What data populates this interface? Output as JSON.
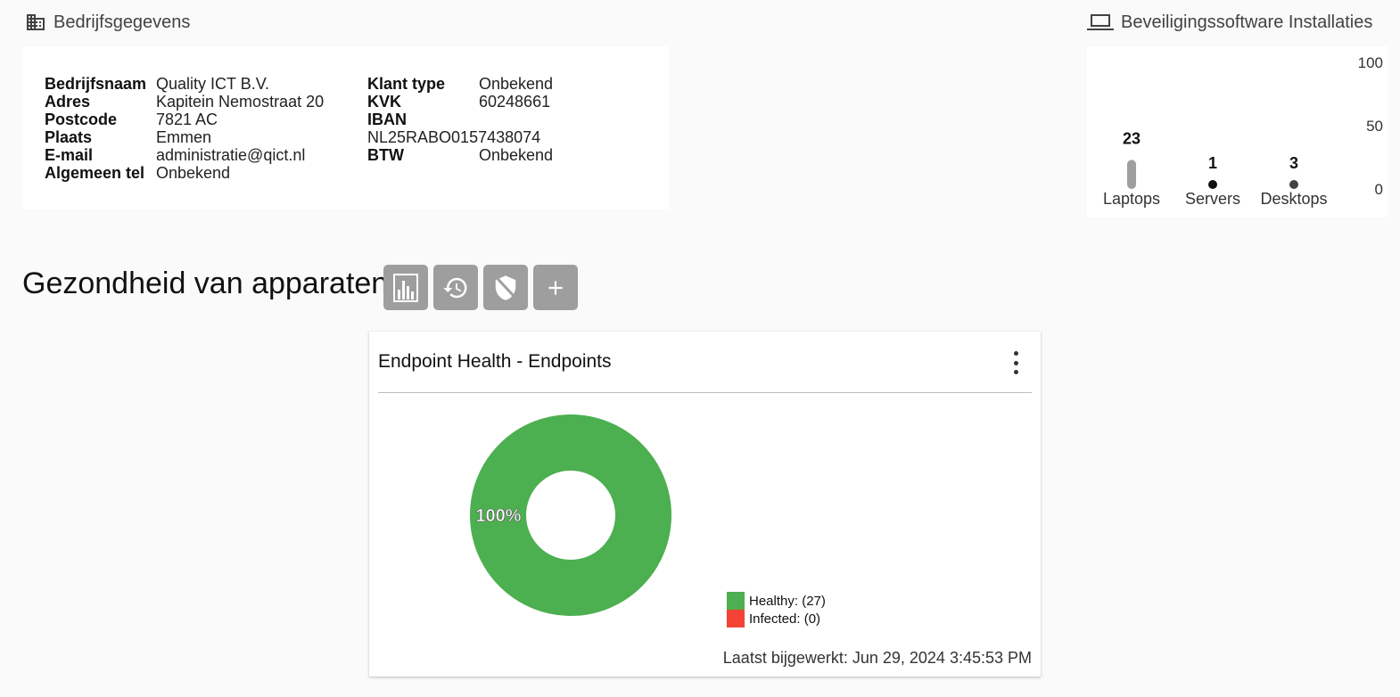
{
  "company": {
    "heading": "Bedrijfsgegevens",
    "left": [
      {
        "key": "Bedrijfsnaam",
        "value": "Quality ICT B.V."
      },
      {
        "key": "Adres",
        "value": "Kapitein Nemostraat 20"
      },
      {
        "key": "Postcode",
        "value": "7821 AC"
      },
      {
        "key": "Plaats",
        "value": "Emmen"
      },
      {
        "key": "E-mail",
        "value": "administratie@qict.nl"
      },
      {
        "key": "Algemeen tel",
        "value": "Onbekend"
      }
    ],
    "right": [
      {
        "key": "Klant type",
        "value": "Onbekend"
      },
      {
        "key": "KVK",
        "value": "60248661"
      },
      {
        "key": "IBAN",
        "value": ""
      },
      {
        "key": "",
        "value": "NL25RABO0157438074"
      },
      {
        "key": "BTW",
        "value": "Onbekend"
      }
    ]
  },
  "installs": {
    "heading": "Beveiligingssoftware Installaties",
    "chart_data": {
      "type": "bar",
      "categories": [
        "Laptops",
        "Servers",
        "Desktops"
      ],
      "values": [
        23,
        1,
        3
      ],
      "ylim": [
        0,
        100
      ],
      "yticks": [
        "100",
        "50",
        "0"
      ],
      "grid": false,
      "colors": [
        "#9e9e9e",
        "#111111",
        "#424242"
      ]
    }
  },
  "health": {
    "title": "Gezondheid van apparaten",
    "buttons": [
      {
        "name": "chart-view-button",
        "icon": "bar-chart-icon"
      },
      {
        "name": "history-button",
        "icon": "history-icon"
      },
      {
        "name": "security-off-button",
        "icon": "shield-off-icon"
      },
      {
        "name": "add-button",
        "icon": "plus-icon"
      }
    ]
  },
  "endpoint": {
    "title": "Endpoint Health - Endpoints",
    "updated": "Laatst bijgewerkt: Jun 29, 2024 3:45:53 PM",
    "chart_data": {
      "type": "pie",
      "donut": true,
      "slices": [
        {
          "label": "Healthy: (27)",
          "value": 27,
          "color": "#4caf50"
        },
        {
          "label": "Infected: (0)",
          "value": 0,
          "color": "#f44336"
        }
      ],
      "center_label": "100%"
    }
  }
}
